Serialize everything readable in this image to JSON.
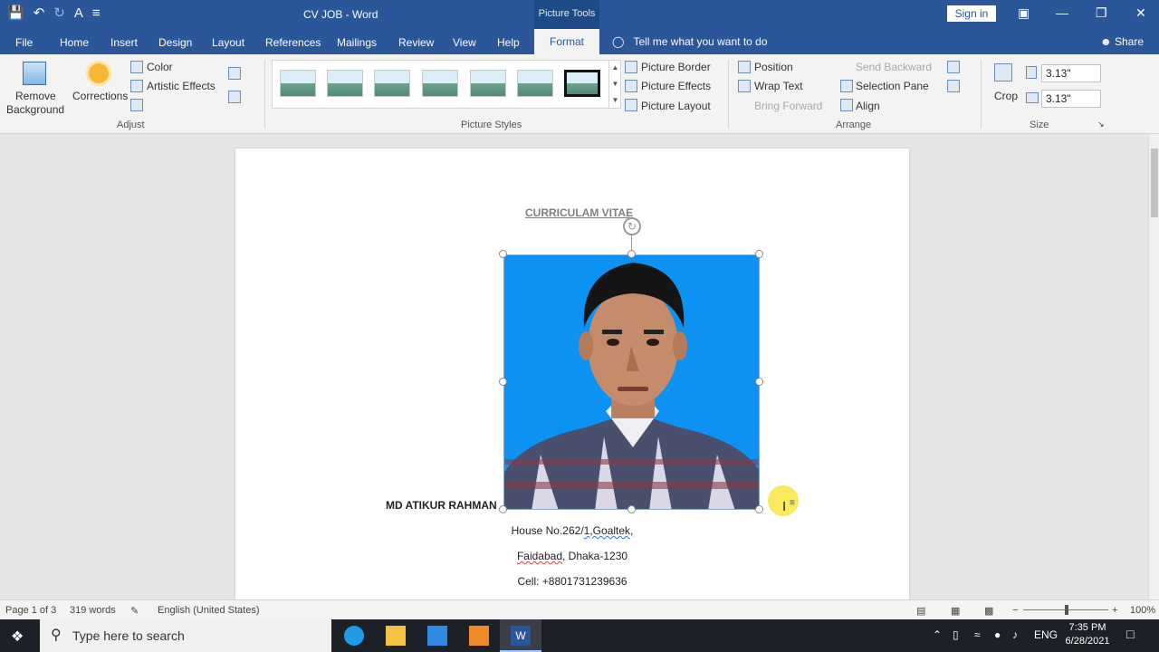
{
  "titlebar": {
    "doc_title": "CV JOB  -  Word",
    "context_title": "Picture Tools",
    "signin": "Sign in"
  },
  "tabs": {
    "file": "File",
    "home": "Home",
    "insert": "Insert",
    "design": "Design",
    "layout": "Layout",
    "references": "References",
    "mailings": "Mailings",
    "review": "Review",
    "view": "View",
    "help": "Help",
    "format": "Format",
    "tell_me": "Tell me what you want to do",
    "share": "Share"
  },
  "ribbon": {
    "adjust": {
      "remove_bg_1": "Remove",
      "remove_bg_2": "Background",
      "corrections": "Corrections",
      "color": "Color",
      "artistic": "Artistic Effects",
      "label": "Adjust"
    },
    "styles": {
      "label": "Picture Styles",
      "border": "Picture Border",
      "effects": "Picture Effects",
      "layout": "Picture Layout"
    },
    "arrange": {
      "label": "Arrange",
      "position": "Position",
      "wrap": "Wrap Text",
      "bring_forward": "Bring Forward",
      "send_backward": "Send Backward",
      "selection_pane": "Selection Pane",
      "align": "Align"
    },
    "size": {
      "label": "Size",
      "crop": "Crop",
      "height": "3.13\"",
      "width": "3.13\""
    }
  },
  "document": {
    "title": "CURRICULAM  VITAE",
    "name": "MD ATIKUR RAHMAN",
    "addr1_a": "House No.262/",
    "addr1_b": "1,Goaltek,",
    "addr2_a": "Faidabad",
    "addr2_b": ", Dhaka-1230",
    "cell": "Cell: +8801731239636"
  },
  "status": {
    "page": "Page 1 of 3",
    "words": "319 words",
    "language": "English (United States)",
    "zoom": "100%"
  },
  "taskbar": {
    "search_placeholder": "Type here to search",
    "lang": "ENG",
    "time": "7:35 PM",
    "date": "6/28/2021"
  }
}
